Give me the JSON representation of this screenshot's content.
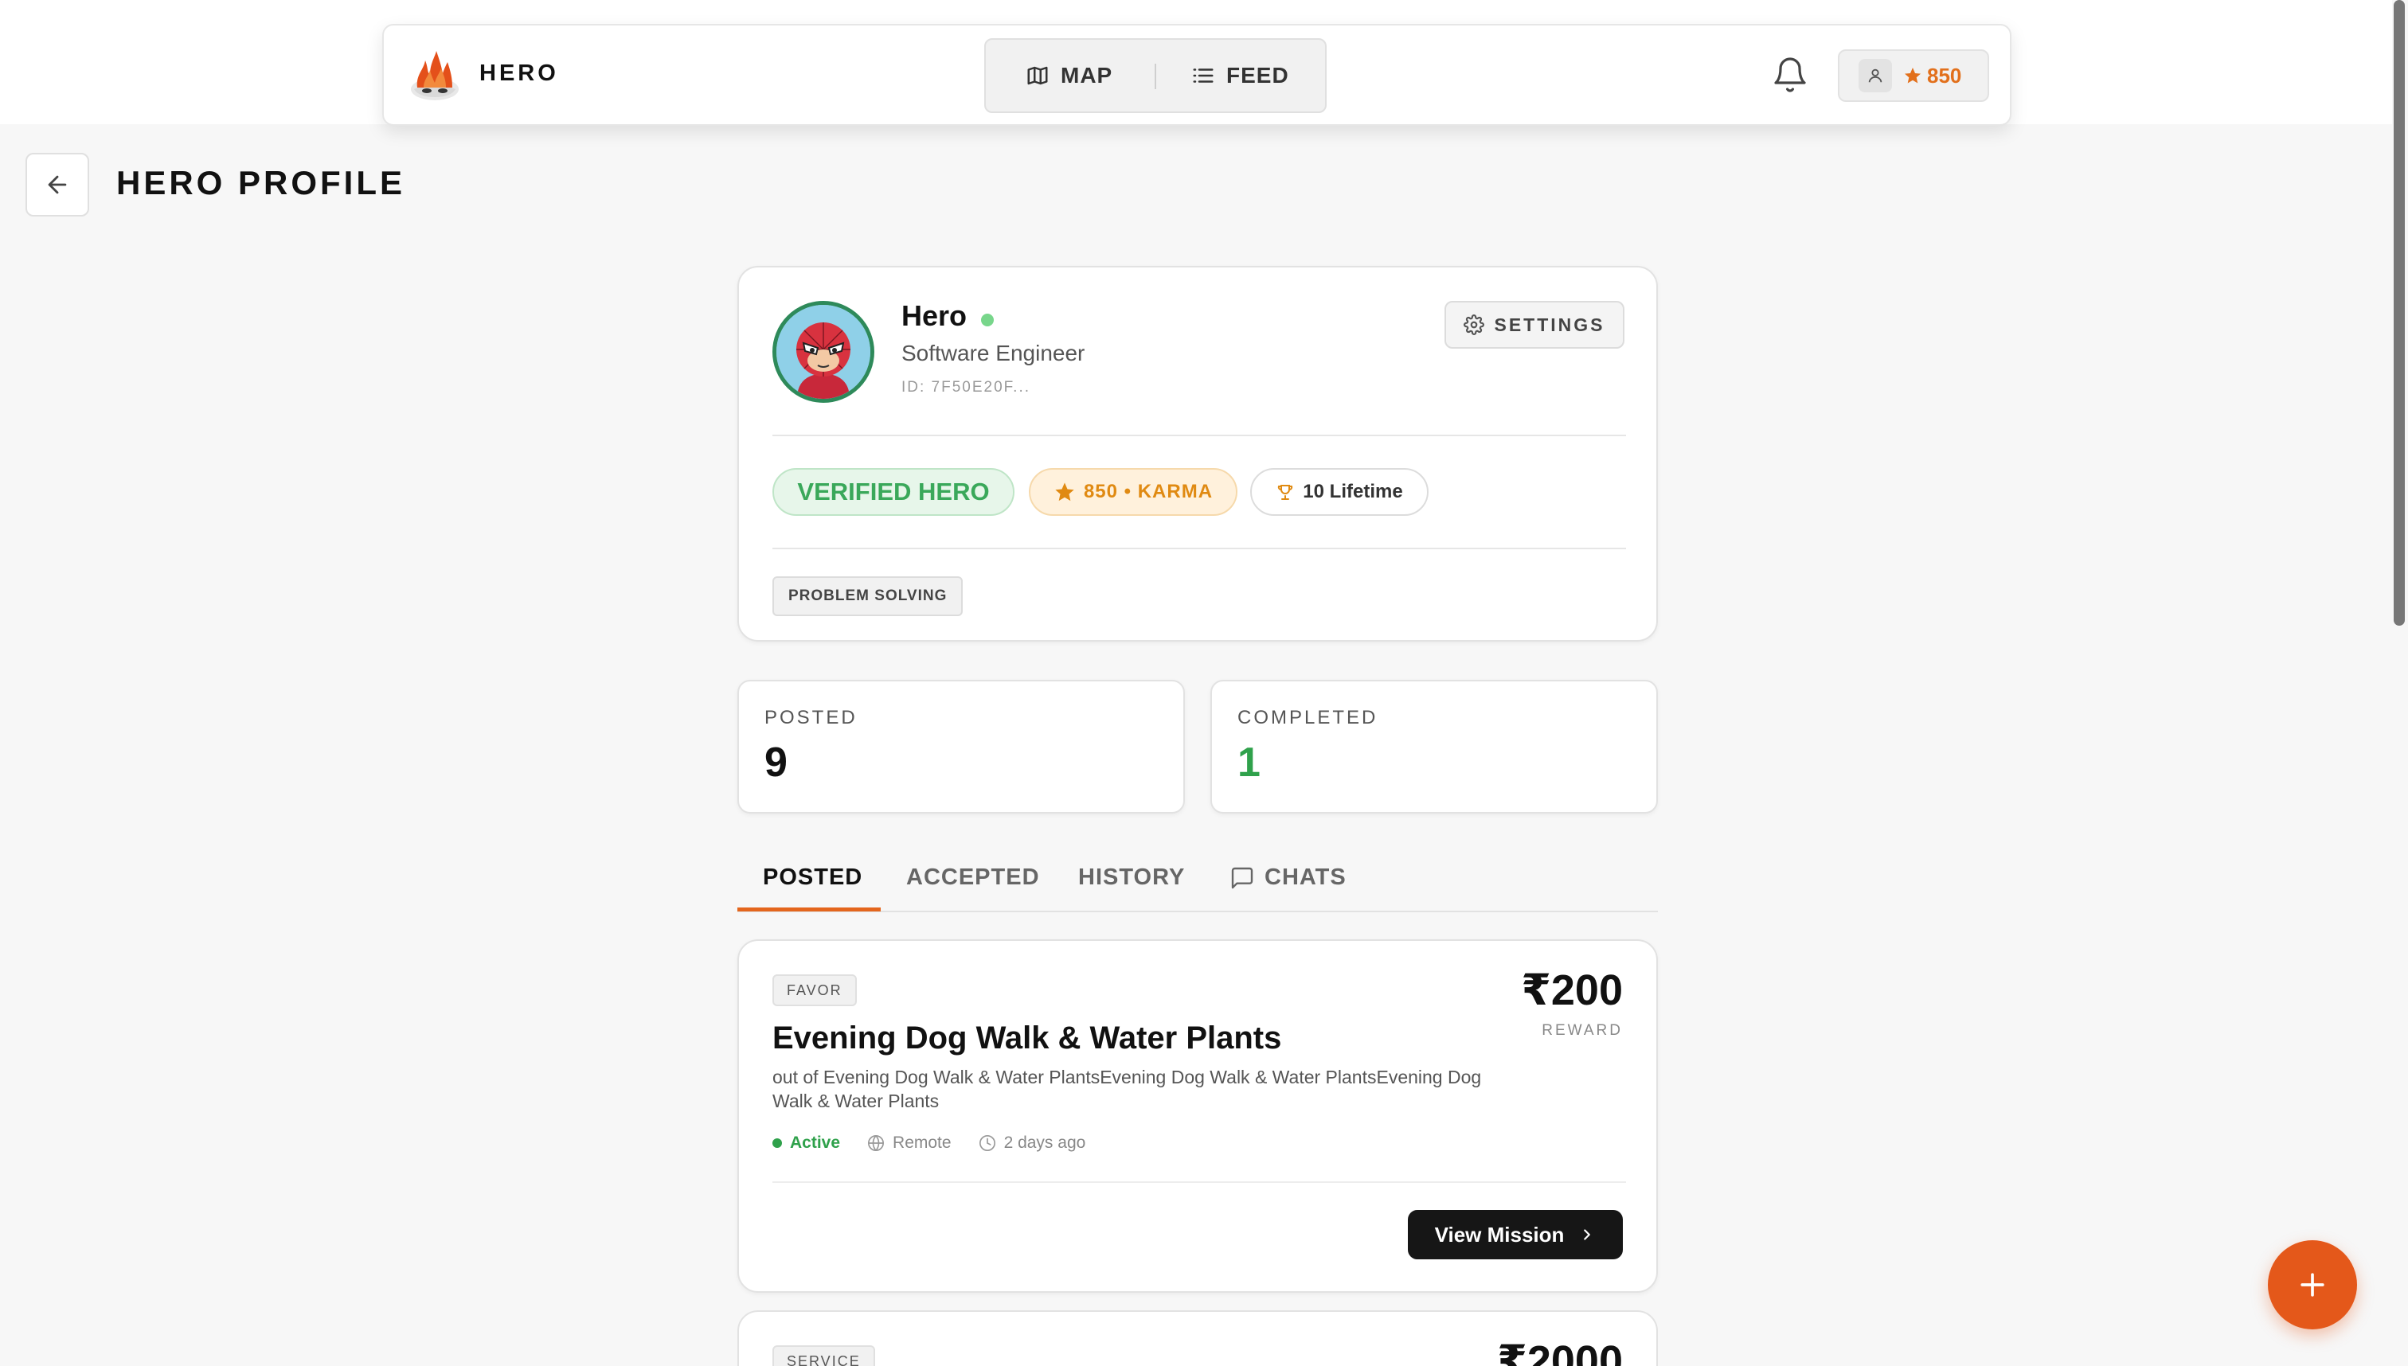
{
  "navbar": {
    "brand": "HERO",
    "logo_icon": "hero-flame-mask-logo",
    "nav": [
      {
        "label": "MAP",
        "icon": "map-icon"
      },
      {
        "label": "FEED",
        "icon": "list-icon"
      }
    ],
    "notifications_icon": "bell-icon",
    "user": {
      "karma": "850",
      "icon": "user-icon"
    }
  },
  "page": {
    "title": "HERO PROFILE",
    "back_icon": "arrow-left-icon"
  },
  "profile": {
    "name": "Hero",
    "role": "Software Engineer",
    "id_text": "ID: 7F50E20F...",
    "online": true,
    "settings_label": "SETTINGS",
    "badges": {
      "verified": "VERIFIED HERO",
      "karma": "850 • KARMA",
      "lifetime": "10 Lifetime"
    },
    "tags": [
      "PROBLEM SOLVING"
    ]
  },
  "stats": {
    "posted": {
      "label": "POSTED",
      "value": "9"
    },
    "completed": {
      "label": "COMPLETED",
      "value": "1"
    }
  },
  "tabs": [
    {
      "label": "POSTED",
      "active": true
    },
    {
      "label": "ACCEPTED",
      "active": false
    },
    {
      "label": "HISTORY",
      "active": false
    },
    {
      "label": "CHATS",
      "active": false,
      "icon": "chat-bubble-icon"
    }
  ],
  "missions": [
    {
      "category": "FAVOR",
      "title": "Evening Dog Walk & Water Plants",
      "description": "out of Evening Dog Walk & Water PlantsEvening Dog Walk & Water PlantsEvening Dog Walk & Water Plants",
      "reward": "₹200",
      "reward_label": "REWARD",
      "status": "Active",
      "location": "Remote",
      "time": "2 days ago",
      "action": "View Mission"
    },
    {
      "category": "SERVICE",
      "reward": "₹2000"
    }
  ],
  "colors": {
    "accent": "#e4581a",
    "success": "#2fa14b",
    "karma": "#e08a12"
  }
}
